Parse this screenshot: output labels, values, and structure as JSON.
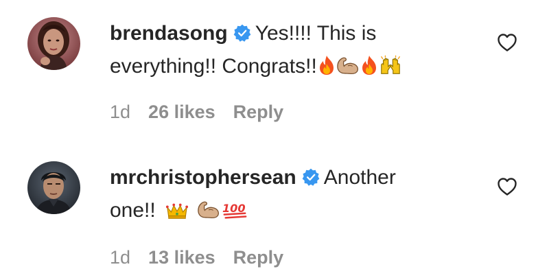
{
  "comments": [
    {
      "username": "brendasong",
      "verified": true,
      "text_line1": "Yes!!!! This is",
      "text_line2": "everything!! Congrats!!",
      "emojis": [
        "fire-emoji",
        "flexed-biceps-emoji",
        "fire-emoji",
        "raising-hands-emoji"
      ],
      "time": "1d",
      "likes": "26 likes",
      "reply": "Reply"
    },
    {
      "username": "mrchristophersean",
      "verified": true,
      "text_line1": "Another",
      "text_line2": "one!!",
      "emojis": [
        "crown-emoji",
        "flexed-biceps-emoji",
        "hundred-points-emoji"
      ],
      "time": "1d",
      "likes": "13 likes",
      "reply": "Reply"
    }
  ],
  "colors": {
    "text": "#262626",
    "meta": "#8e8e8e",
    "verified": "#3897f0"
  }
}
